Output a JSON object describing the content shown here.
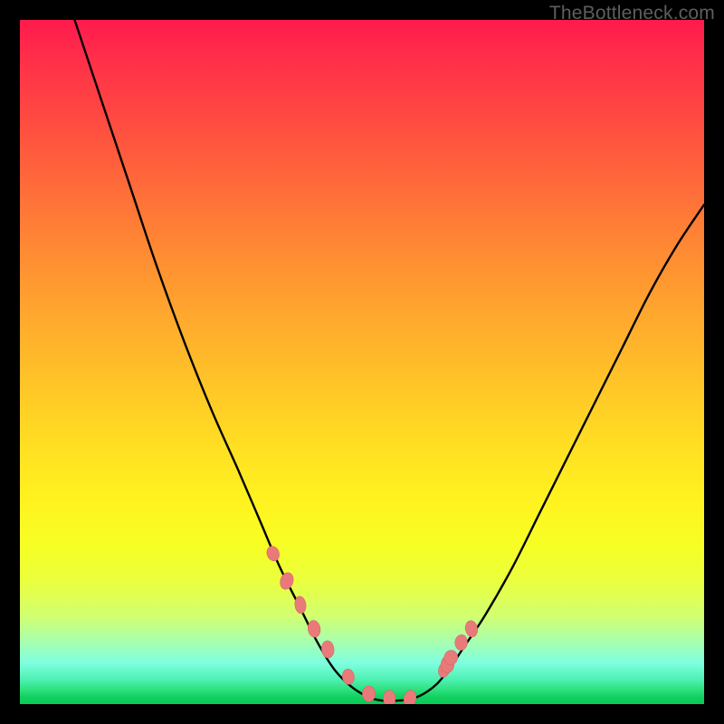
{
  "watermark": "TheBottleneck.com",
  "colors": {
    "frame": "#000000",
    "curve": "#000000",
    "marker": "#e97a7a",
    "marker_stroke": "#d85f5f"
  },
  "chart_data": {
    "type": "line",
    "title": "",
    "xlabel": "",
    "ylabel": "",
    "xlim": [
      0,
      100
    ],
    "ylim": [
      0,
      100
    ],
    "grid": false,
    "legend": false,
    "series": [
      {
        "name": "bottleneck-curve",
        "x": [
          8,
          12,
          16,
          20,
          24,
          28,
          32,
          35,
          38,
          41,
          43.5,
          46,
          48.5,
          51,
          53,
          55,
          57,
          59,
          61,
          63,
          65,
          68,
          72,
          76,
          80,
          84,
          88,
          92,
          96,
          100
        ],
        "values": [
          100,
          88,
          76,
          64,
          53,
          43,
          34,
          27,
          20,
          14,
          9,
          5,
          2.5,
          1,
          0.5,
          0.5,
          0.7,
          1.5,
          3,
          5.5,
          8.5,
          13,
          20,
          28,
          36,
          44,
          52,
          60,
          67,
          73
        ]
      }
    ],
    "markers": {
      "name": "highlight-points",
      "x": [
        37,
        39,
        41,
        43,
        45,
        48,
        51,
        54,
        57,
        62,
        62.5,
        63,
        64.5,
        66
      ],
      "values": [
        22,
        18,
        14.5,
        11,
        8,
        4,
        1.5,
        0.8,
        0.8,
        5,
        5.8,
        6.8,
        9,
        11
      ]
    },
    "annotations": []
  }
}
